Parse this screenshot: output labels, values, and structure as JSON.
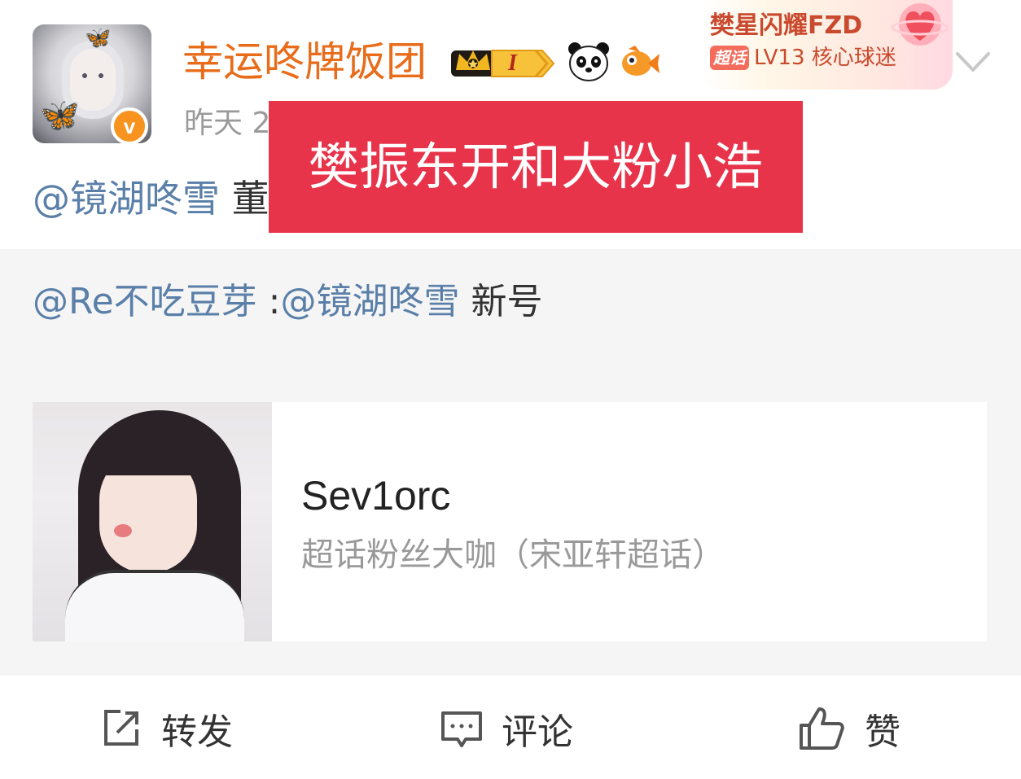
{
  "post": {
    "username": "幸运咚牌饭团",
    "level_badge": "I",
    "time_prefix": "昨天 2",
    "fan_badge": {
      "title": "樊星闪耀FZD",
      "chip": "超话",
      "level": "LV13 核心球迷"
    },
    "mention": "@镜湖咚雪",
    "mention_tail": "董",
    "overlay_text": "樊振东开和大粉小浩"
  },
  "repost": {
    "author_mention": "@Re不吃豆芽",
    "separator": " :",
    "target_mention": "@镜湖咚雪",
    "text": " 新号",
    "card": {
      "title": "Sev1orc",
      "subtitle": "超话粉丝大咖（宋亚轩超话）"
    }
  },
  "actions": {
    "repost_label": "转发",
    "comment_label": "评论",
    "like_label": "赞"
  },
  "colors": {
    "username": "#e86c1a",
    "mention": "#5a7fa8",
    "overlay": "#e8344a",
    "verified": "#f7931e"
  }
}
